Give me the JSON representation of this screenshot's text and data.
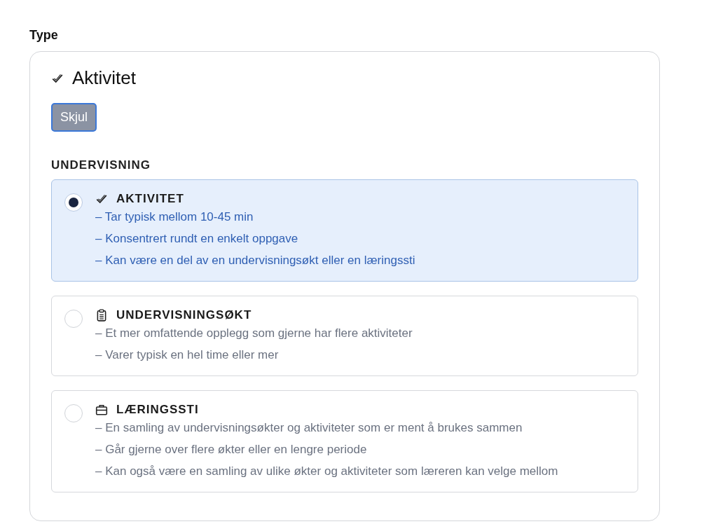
{
  "field_label": "Type",
  "card": {
    "heading": "Aktivitet",
    "toggle_button": "Skjul",
    "section_title": "UNDERVISNING",
    "options": [
      {
        "title": "AKTIVITET",
        "kind": "activity",
        "selected": true,
        "lines": [
          "– Tar typisk mellom 10-45 min",
          "– Konsentrert rundt en enkelt oppgave",
          "– Kan være en del av en undervisningsøkt eller en læringssti"
        ]
      },
      {
        "title": "UNDERVISNINGSØKT",
        "kind": "session",
        "selected": false,
        "lines": [
          "– Et mer omfattende opplegg som gjerne har flere aktiviteter",
          "– Varer typisk en hel time eller mer"
        ]
      },
      {
        "title": "LÆRINGSSTI",
        "kind": "path",
        "selected": false,
        "lines": [
          "– En samling av undervisningsøkter og aktiviteter som er ment å brukes sammen",
          "– Går gjerne over flere økter eller en lengre periode",
          "– Kan også være en samling av ulike økter og aktiviteter som læreren kan velge mellom"
        ]
      }
    ]
  }
}
